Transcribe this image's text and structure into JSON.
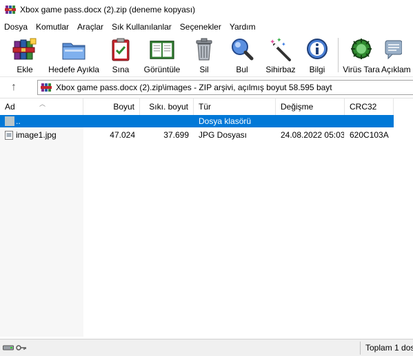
{
  "window": {
    "title": "Xbox game pass.docx (2).zip (deneme kopyası)"
  },
  "menu": [
    "Dosya",
    "Komutlar",
    "Araçlar",
    "Sık Kullanılanlar",
    "Seçenekler",
    "Yardım"
  ],
  "toolbar": [
    {
      "label": "Ekle",
      "icon": "add-archive-icon"
    },
    {
      "label": "Hedefe Ayıkla",
      "icon": "extract-folder-icon"
    },
    {
      "label": "Sına",
      "icon": "test-clipboard-icon"
    },
    {
      "label": "Görüntüle",
      "icon": "view-book-icon"
    },
    {
      "label": "Sil",
      "icon": "trash-icon"
    },
    {
      "label": "Bul",
      "icon": "find-magnifier-icon"
    },
    {
      "label": "Sihirbaz",
      "icon": "wizard-wand-icon"
    },
    {
      "label": "Bilgi",
      "icon": "info-icon"
    },
    {
      "label": "Virüs Tara",
      "icon": "virus-scan-icon"
    },
    {
      "label": "Açıklam",
      "icon": "comment-icon"
    }
  ],
  "address": {
    "up_icon": "↑",
    "path": "Xbox game pass.docx (2).zip\\images - ZIP arşivi, açılmış boyut 58.595 bayt"
  },
  "columns": {
    "name": "Ad",
    "size": "Boyut",
    "packed": "Sıkı. boyut",
    "type": "Tür",
    "modified": "Değişme",
    "crc": "CRC32"
  },
  "rows": [
    {
      "name": "..",
      "size": "",
      "packed": "",
      "type": "Dosya klasörü",
      "modified": "",
      "crc": "",
      "selected": true
    },
    {
      "name": "image1.jpg",
      "size": "47.024",
      "packed": "37.699",
      "type": "JPG Dosyası",
      "modified": "24.08.2022 05:03",
      "crc": "620C103A",
      "selected": false
    }
  ],
  "status": {
    "text": "Toplam 1 dos"
  },
  "colors": {
    "selection": "#0078d7",
    "winrar_red": "#c4262e",
    "winrar_blue": "#2a5ca8"
  }
}
